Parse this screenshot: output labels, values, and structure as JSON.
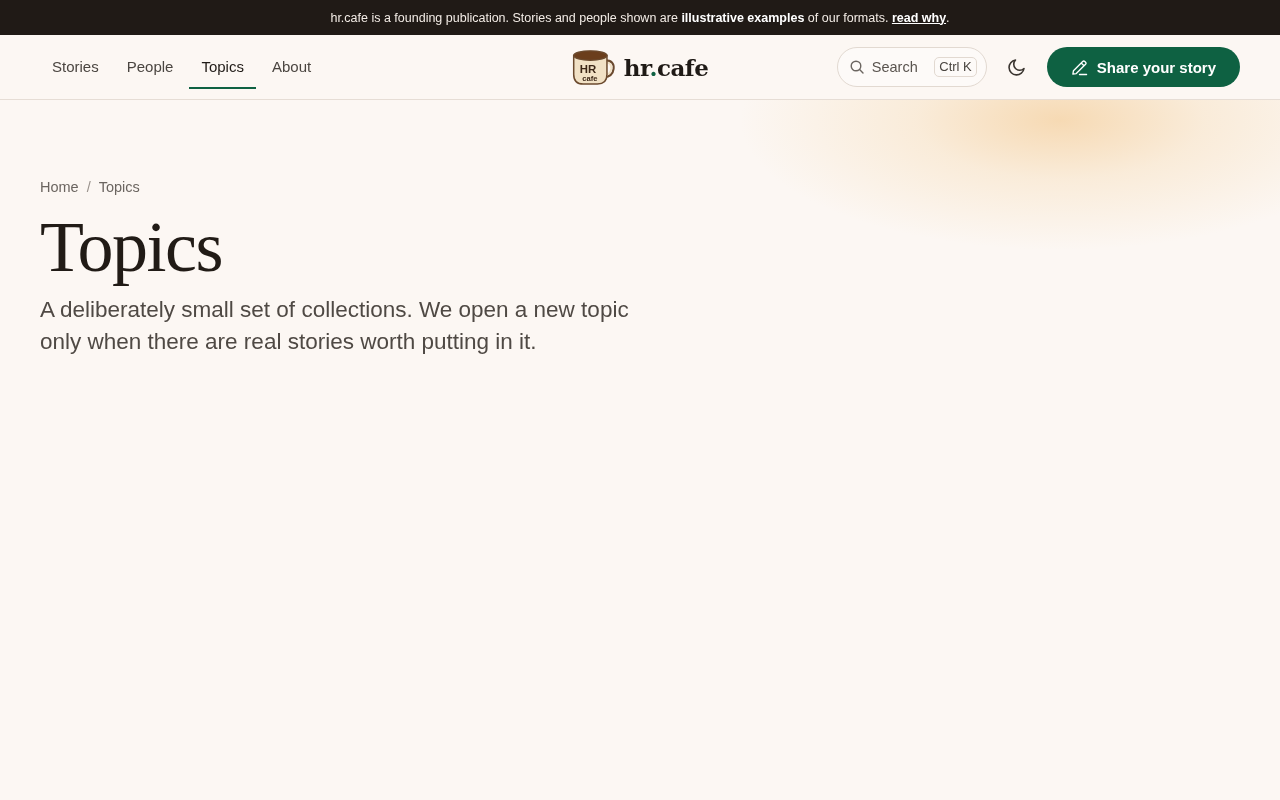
{
  "announcement": {
    "text": "hr.cafe is a founding publication. Stories and people shown are **illustrative examples** of our formats. ",
    "link": "read why",
    "after": "."
  },
  "nav": [
    {
      "label": "Stories",
      "selected": false
    },
    {
      "label": "People",
      "selected": false
    },
    {
      "label": "Topics",
      "selected": true
    },
    {
      "label": "About",
      "selected": false
    }
  ],
  "logo": {
    "mug_label": "HR",
    "mug_sublabel": "cafe",
    "parts": [
      "hr",
      ".",
      "cafe"
    ]
  },
  "search": {
    "placeholder": "Search",
    "shortcut": "Ctrl K"
  },
  "share_button": {
    "label": "Share your story"
  },
  "breadcrumb": {
    "items": [
      "Home",
      "Topics"
    ],
    "separator": "/"
  },
  "page": {
    "title": "Topics",
    "intro": "A deliberately small set of collections. We open a new topic only when there are real stories worth putting in it."
  }
}
